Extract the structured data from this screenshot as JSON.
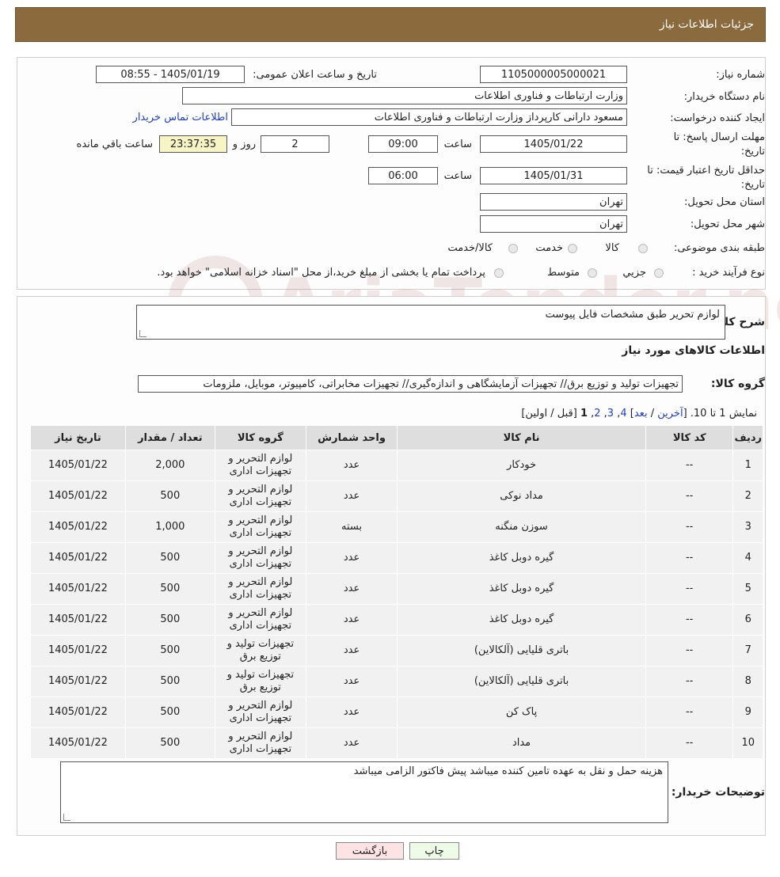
{
  "header": {
    "title": "جزئیات اطلاعات نیاز"
  },
  "info": {
    "need_number_label": "شماره نیاز:",
    "need_number": "1105000005000021",
    "announce_label": "تاریخ و ساعت اعلان عمومی:",
    "announce_value": "1405/01/19 - 08:55",
    "buyer_org_label": "نام دستگاه خریدار:",
    "buyer_org": "وزارت ارتباطات و فناوری اطلاعات",
    "creator_label": "ایجاد کننده درخواست:",
    "creator": "مسعود دارانی کارپرداز وزارت ارتباطات و فناوری اطلاعات",
    "contact_link": "اطلاعات تماس خریدار",
    "deadline_label": "مهلت ارسال پاسخ: تا تاریخ:",
    "deadline_date": "1405/01/22",
    "time_label": "ساعت",
    "deadline_time": "09:00",
    "days_value": "2",
    "days_label": "روز و",
    "remaining_time": "23:37:35",
    "remaining_label": "ساعت باقي مانده",
    "validity_label": "حداقل تاریخ اعتبار قیمت: تا تاریخ:",
    "validity_date": "1405/01/31",
    "validity_time": "06:00",
    "province_label": "استان محل تحویل:",
    "province": "تهران",
    "city_label": "شهر محل تحویل:",
    "city": "تهران",
    "category_label": "طبقه بندی موضوعی:",
    "category_options": [
      "کالا",
      "خدمت",
      "کالا/خدمت"
    ],
    "process_label": "نوع فرآیند خرید :",
    "process_options": [
      "جزيي",
      "متوسط"
    ],
    "process_note": "پرداخت تمام یا بخشی از مبلغ خرید،از محل \"اسناد خزانه اسلامی\" خواهد بود."
  },
  "details": {
    "summary_label": "شرح كلي نياز:",
    "summary": "لوازم تحریر طبق مشخصات فایل پیوست",
    "goods_info_title": "اطلاعات کالاهای مورد نیاز",
    "goods_group_label": "گروه کالا:",
    "goods_group": "تجهیزات تولید و توزیع برق// تجهیزات آزمایشگاهی و اندازه‌گیری// تجهیزات مخابراتی، کامپیوتر، موبایل، ملزومات",
    "pager": {
      "prefix": "نمایش 1 تا 10. [",
      "last": "آخرین",
      "sep1": " / ",
      "next": "بعد",
      "pages": [
        "4",
        "3",
        "2"
      ],
      "current": "1",
      "suffix": " [قبل / اولین]"
    },
    "table": {
      "headers": [
        "ردیف",
        "کد کالا",
        "نام کالا",
        "واحد شمارش",
        "گروه کالا",
        "تعداد / مقدار",
        "تاریخ نیاز"
      ],
      "rows": [
        [
          "1",
          "--",
          "خودکار",
          "عدد",
          "لوازم التحریر و تجهیزات اداری",
          "2,000",
          "1405/01/22"
        ],
        [
          "2",
          "--",
          "مداد نوکی",
          "عدد",
          "لوازم التحریر و تجهیزات اداری",
          "500",
          "1405/01/22"
        ],
        [
          "3",
          "--",
          "سوزن منگنه",
          "بسته",
          "لوازم التحریر و تجهیزات اداری",
          "1,000",
          "1405/01/22"
        ],
        [
          "4",
          "--",
          "گیره دوبل کاغذ",
          "عدد",
          "لوازم التحریر و تجهیزات اداری",
          "500",
          "1405/01/22"
        ],
        [
          "5",
          "--",
          "گیره دوبل کاغذ",
          "عدد",
          "لوازم التحریر و تجهیزات اداری",
          "500",
          "1405/01/22"
        ],
        [
          "6",
          "--",
          "گیره دوبل کاغذ",
          "عدد",
          "لوازم التحریر و تجهیزات اداری",
          "500",
          "1405/01/22"
        ],
        [
          "7",
          "--",
          "باتری قلیایی (آلکالاین)",
          "عدد",
          "تجهیزات تولید و توزیع برق",
          "500",
          "1405/01/22"
        ],
        [
          "8",
          "--",
          "باتری قلیایی (آلکالاین)",
          "عدد",
          "تجهیزات تولید و توزیع برق",
          "500",
          "1405/01/22"
        ],
        [
          "9",
          "--",
          "پاک کن",
          "عدد",
          "لوازم التحریر و تجهیزات اداری",
          "500",
          "1405/01/22"
        ],
        [
          "10",
          "--",
          "مداد",
          "عدد",
          "لوازم التحریر و تجهیزات اداری",
          "500",
          "1405/01/22"
        ]
      ]
    },
    "buyer_notes_label": "توضیحات خریدار:",
    "buyer_notes": "هزینه حمل و نقل به عهده تامین کننده میباشد پیش فاکتور الزامی میباشد"
  },
  "buttons": {
    "print": "چاپ",
    "back": "بازگشت"
  },
  "watermark": {
    "text": "AriaTender.neT"
  }
}
